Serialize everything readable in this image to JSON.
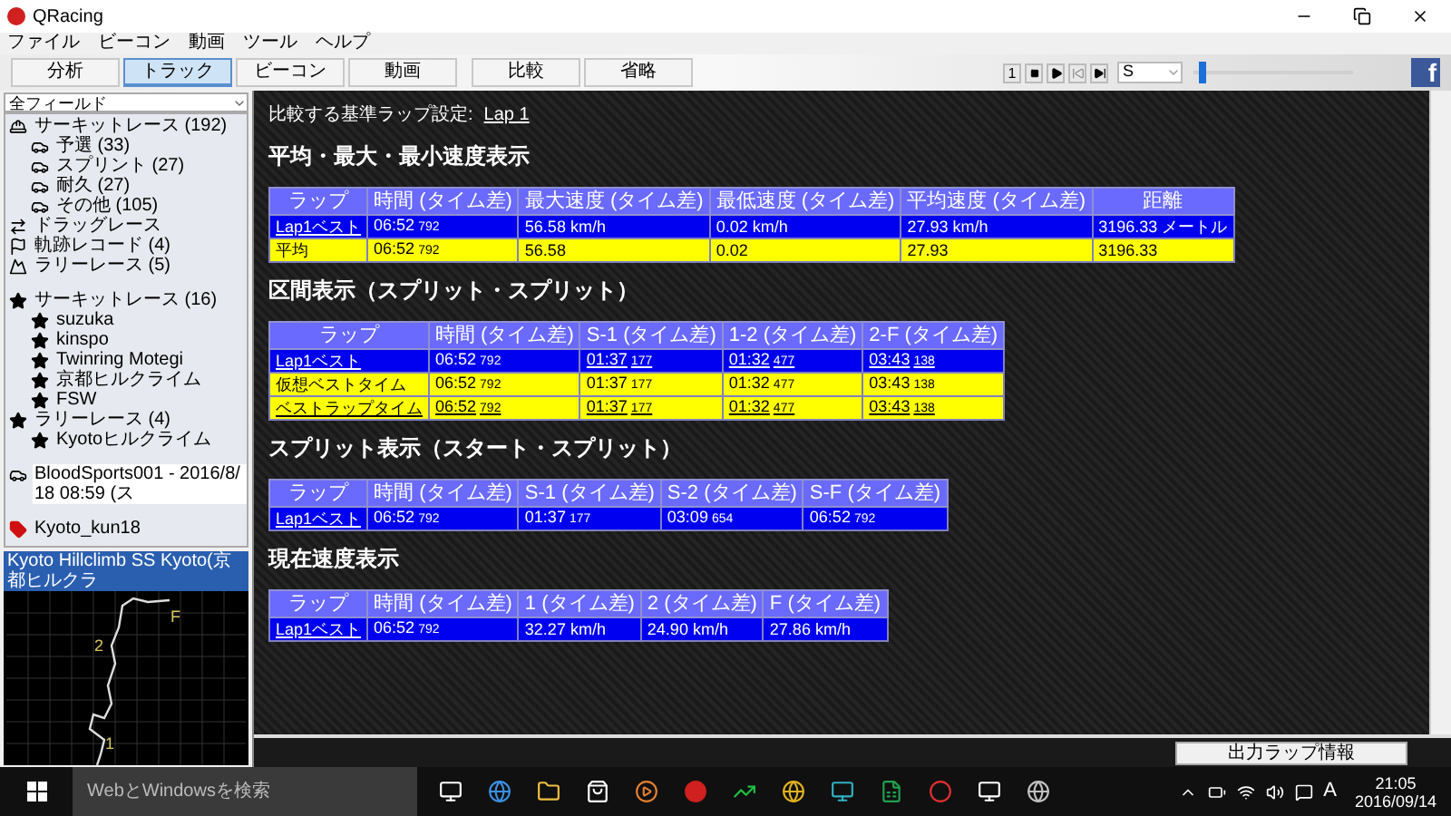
{
  "window": {
    "title": "QRacing"
  },
  "menu": [
    "ファイル",
    "ビーコン",
    "動画",
    "ツール",
    "ヘルプ"
  ],
  "tabs": [
    {
      "label": "分析",
      "selected": false
    },
    {
      "label": "トラック",
      "selected": true
    },
    {
      "label": "ビーコン",
      "selected": false
    },
    {
      "label": "動画",
      "selected": false
    },
    {
      "label": "比較",
      "selected": false
    },
    {
      "label": "省略",
      "selected": false
    }
  ],
  "playback": {
    "first_button": "1",
    "speed": "S",
    "level": 0.03,
    "social": "f"
  },
  "sidebar": {
    "filter": "全フィールド",
    "tree_groups": [
      [
        {
          "label": "サーキットレース (192)",
          "kind": "helmet",
          "selected": false,
          "children": [
            {
              "label": "予選 (33)",
              "kind": "car",
              "selected": false
            },
            {
              "label": "スプリント (27)",
              "kind": "car",
              "selected": false
            },
            {
              "label": "耐久 (27)",
              "kind": "car",
              "selected": false
            },
            {
              "label": "その他 (105)",
              "kind": "car",
              "selected": false
            }
          ]
        },
        {
          "label": "ドラッグレース",
          "kind": "arrows",
          "selected": false
        },
        {
          "label": "軌跡レコード (4)",
          "kind": "flag",
          "selected": false
        },
        {
          "label": "ラリーレース (5)",
          "kind": "rally",
          "selected": false
        }
      ],
      [
        {
          "label": "サーキットレース (16)",
          "kind": "star",
          "selected": false,
          "children": [
            {
              "label": "suzuka",
              "kind": "star",
              "selected": false
            },
            {
              "label": "kinspo",
              "kind": "star",
              "selected": false
            },
            {
              "label": "Twinring Motegi",
              "kind": "star",
              "selected": false
            },
            {
              "label": "京都ヒルクライム",
              "kind": "star",
              "selected": false
            },
            {
              "label": "FSW",
              "kind": "star",
              "selected": false
            }
          ]
        },
        {
          "label": "ラリーレース (4)",
          "kind": "star",
          "selected": false,
          "children": [
            {
              "label": "Kyotoヒルクライム",
              "kind": "star",
              "selected": false
            }
          ]
        }
      ],
      [
        {
          "label": "BloodSports001 - 2016/8/18 08:59 (ス",
          "kind": "car",
          "selected": true
        }
      ],
      [
        {
          "label": "Kyoto_kun18",
          "kind": "tag",
          "selected": false
        }
      ]
    ],
    "track_select": "Kyoto Hillclimb SS Kyoto(京都ヒルクラ",
    "map_labels": [
      "F",
      "2",
      "1"
    ]
  },
  "main": {
    "reference_label": "比較する基準ラップ設定:",
    "reference_link": "Lap 1",
    "sections": [
      {
        "heading": "平均・最大・最小速度表示",
        "columns": [
          "ラップ",
          "時間 (タイム差)",
          "最大速度 (タイム差)",
          "最低速度 (タイム差)",
          "平均速度 (タイム差)",
          "距離"
        ],
        "rows": [
          {
            "kind": "lap",
            "cells": [
              {
                "text": "Lap1ベスト",
                "link": true
              },
              {
                "text": "06:52",
                "sub": "792",
                "link": false
              },
              {
                "text": "56.58 km/h",
                "link": false
              },
              {
                "text": "0.02 km/h",
                "link": false
              },
              {
                "text": "27.93 km/h",
                "link": false
              },
              {
                "text": "3196.33 メートル",
                "link": false
              }
            ]
          },
          {
            "kind": "summary",
            "cells": [
              {
                "text": "平均",
                "link": false
              },
              {
                "text": "06:52",
                "sub": "792",
                "link": false
              },
              {
                "text": "56.58",
                "link": false
              },
              {
                "text": "0.02",
                "link": false
              },
              {
                "text": "27.93",
                "link": false
              },
              {
                "text": "3196.33",
                "link": false
              }
            ]
          }
        ]
      },
      {
        "heading": "区間表示（スプリット・スプリット）",
        "columns": [
          "ラップ",
          "時間 (タイム差)",
          "S-1 (タイム差)",
          "1-2 (タイム差)",
          "2-F (タイム差)"
        ],
        "rows": [
          {
            "kind": "lap",
            "cells": [
              {
                "text": "Lap1ベスト",
                "link": true
              },
              {
                "text": "06:52",
                "sub": "792",
                "link": false
              },
              {
                "text": "01:37",
                "sub": "177",
                "link": true
              },
              {
                "text": "01:32",
                "sub": "477",
                "link": true
              },
              {
                "text": "03:43",
                "sub": "138",
                "link": true
              }
            ]
          },
          {
            "kind": "summary",
            "cells": [
              {
                "text": "仮想ベストタイム",
                "link": false
              },
              {
                "text": "06:52",
                "sub": "792",
                "link": false
              },
              {
                "text": "01:37",
                "sub": "177",
                "link": false
              },
              {
                "text": "01:32",
                "sub": "477",
                "link": false
              },
              {
                "text": "03:43",
                "sub": "138",
                "link": false
              }
            ]
          },
          {
            "kind": "summary",
            "cells": [
              {
                "text": "ベストラップタイム",
                "link": true
              },
              {
                "text": "06:52",
                "sub": "792",
                "link": true
              },
              {
                "text": "01:37",
                "sub": "177",
                "link": true
              },
              {
                "text": "01:32",
                "sub": "477",
                "link": true
              },
              {
                "text": "03:43",
                "sub": "138",
                "link": true
              }
            ]
          }
        ]
      },
      {
        "heading": "スプリット表示（スタート・スプリット）",
        "columns": [
          "ラップ",
          "時間 (タイム差)",
          "S-1 (タイム差)",
          "S-2 (タイム差)",
          "S-F (タイム差)"
        ],
        "rows": [
          {
            "kind": "lap",
            "cells": [
              {
                "text": "Lap1ベスト",
                "link": true
              },
              {
                "text": "06:52",
                "sub": "792",
                "link": false
              },
              {
                "text": "01:37",
                "sub": "177",
                "link": false
              },
              {
                "text": "03:09",
                "sub": "654",
                "link": false
              },
              {
                "text": "06:52",
                "sub": "792",
                "link": false
              }
            ]
          }
        ]
      },
      {
        "heading": "現在速度表示",
        "columns": [
          "ラップ",
          "時間 (タイム差)",
          "1 (タイム差)",
          "2 (タイム差)",
          "F (タイム差)"
        ],
        "rows": [
          {
            "kind": "lap",
            "cells": [
              {
                "text": "Lap1ベスト",
                "link": true
              },
              {
                "text": "06:52",
                "sub": "792",
                "link": false
              },
              {
                "text": "32.27 km/h",
                "link": false
              },
              {
                "text": "24.90 km/h",
                "link": false
              },
              {
                "text": "27.86 km/h",
                "link": false
              }
            ]
          }
        ]
      }
    ]
  },
  "output_button": "出力ラップ情報",
  "taskbar": {
    "search_placeholder": "WebとWindowsを検索",
    "ime": "A",
    "time": "21:05",
    "date": "2016/09/14"
  }
}
